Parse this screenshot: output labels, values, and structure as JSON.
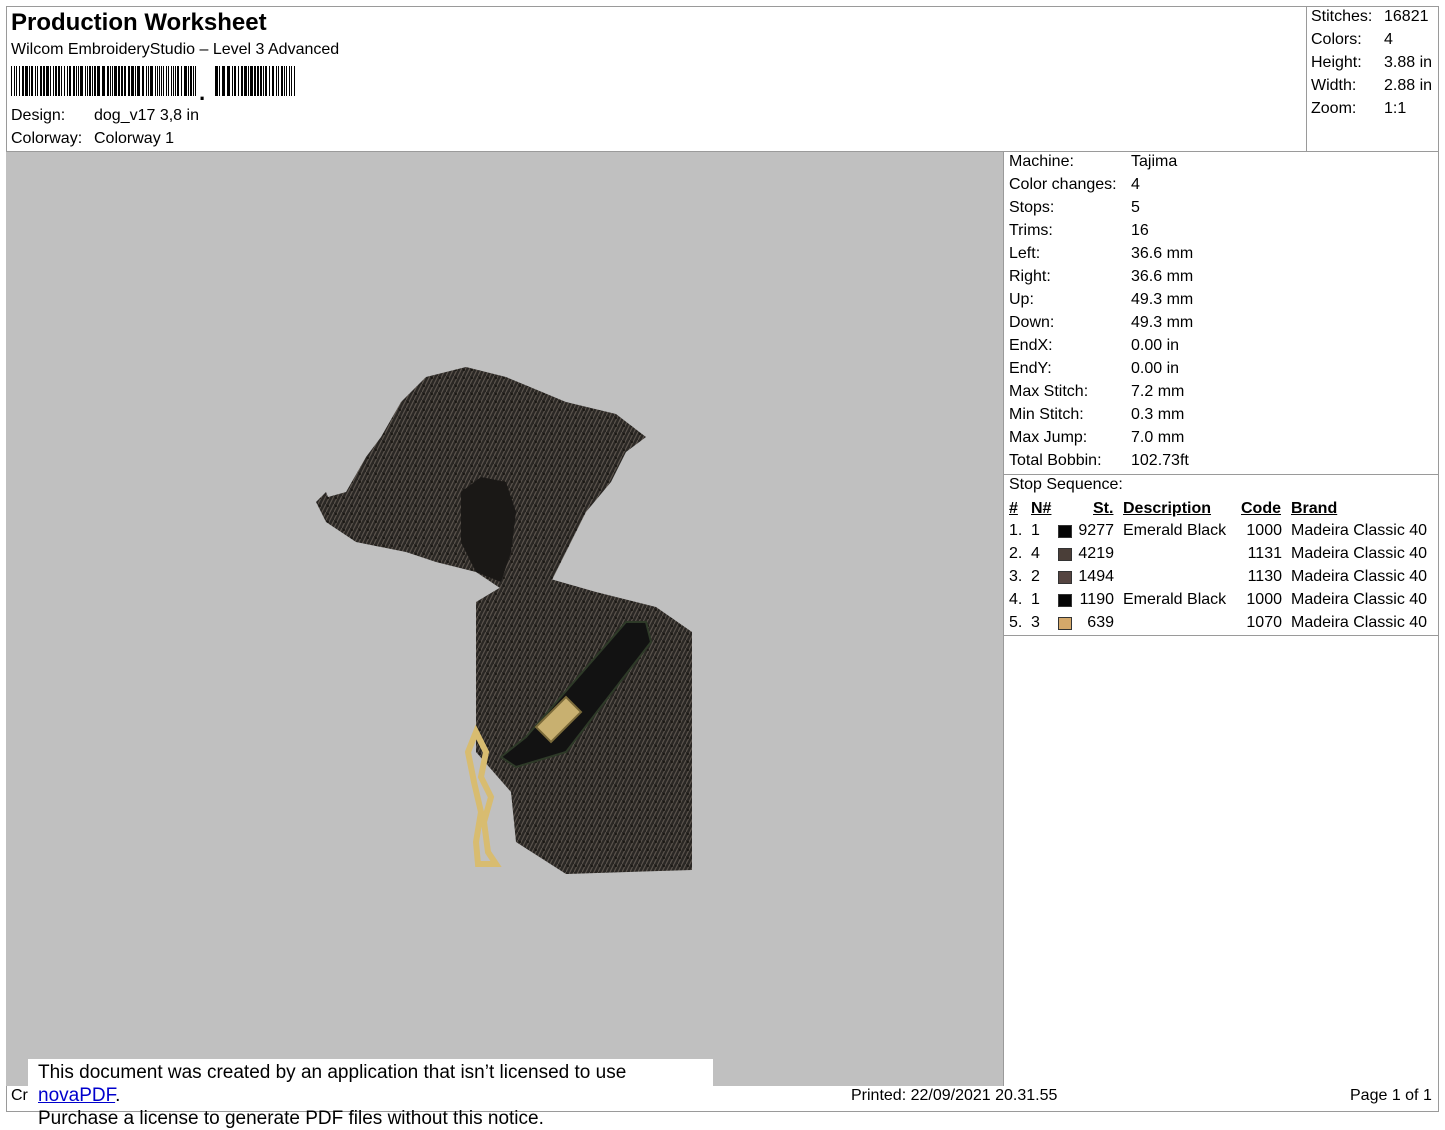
{
  "header": {
    "title": "Production Worksheet",
    "software": "Wilcom EmbroideryStudio – Level 3 Advanced",
    "design_label": "Design:",
    "design_value": "dog_v17 3,8 in",
    "colorway_label": "Colorway:",
    "colorway_value": "Colorway 1"
  },
  "summary": {
    "stitches_label": "Stitches:",
    "stitches_value": "16821",
    "colors_label": "Colors:",
    "colors_value": "4",
    "height_label": "Height:",
    "height_value": "3.88 in",
    "width_label": "Width:",
    "width_value": "2.88 in",
    "zoom_label": "Zoom:",
    "zoom_value": "1:1"
  },
  "stats": [
    {
      "label": "Machine:",
      "value": "Tajima"
    },
    {
      "label": "Color changes:",
      "value": "4"
    },
    {
      "label": "Stops:",
      "value": "5"
    },
    {
      "label": "Trims:",
      "value": "16"
    },
    {
      "label": "Left:",
      "value": "36.6 mm"
    },
    {
      "label": "Right:",
      "value": "36.6 mm"
    },
    {
      "label": "Up:",
      "value": "49.3 mm"
    },
    {
      "label": "Down:",
      "value": "49.3 mm"
    },
    {
      "label": "EndX:",
      "value": "0.00 in"
    },
    {
      "label": "EndY:",
      "value": "0.00 in"
    },
    {
      "label": "Max Stitch:",
      "value": "7.2 mm"
    },
    {
      "label": "Min Stitch:",
      "value": "0.3 mm"
    },
    {
      "label": "Max Jump:",
      "value": "7.0 mm"
    },
    {
      "label": "Total Bobbin:",
      "value": "102.73ft"
    }
  ],
  "stop_sequence": {
    "label": "Stop Sequence:",
    "headers": {
      "num": "#",
      "n": "N#",
      "st": "St.",
      "description": "Description",
      "code": "Code",
      "brand": "Brand"
    },
    "rows": [
      {
        "num": "1.",
        "n": "1",
        "color": "#050505",
        "st": "9277",
        "description": "Emerald Black",
        "code": "1000",
        "brand": "Madeira Classic 40"
      },
      {
        "num": "2.",
        "n": "4",
        "color": "#4a3e38",
        "st": "4219",
        "description": "",
        "code": "1131",
        "brand": "Madeira Classic 40"
      },
      {
        "num": "3.",
        "n": "2",
        "color": "#544440",
        "st": "1494",
        "description": "",
        "code": "1130",
        "brand": "Madeira Classic 40"
      },
      {
        "num": "4.",
        "n": "1",
        "color": "#050505",
        "st": "1190",
        "description": "Emerald Black",
        "code": "1000",
        "brand": "Madeira Classic 40"
      },
      {
        "num": "5.",
        "n": "3",
        "color": "#d4a86a",
        "st": "639",
        "description": "",
        "code": "1070",
        "brand": "Madeira Classic 40"
      }
    ]
  },
  "footer": {
    "left_fragment": "Cr",
    "printed": "Printed: 22/09/2021 20.31.55",
    "page": "Page 1 of 1"
  },
  "notice": {
    "line1_prefix": "This document was created by an application that isn’t licensed to use ",
    "link": "novaPDF",
    "line1_suffix": ".",
    "line2": "Purchase a license to generate PDF files without this notice."
  }
}
